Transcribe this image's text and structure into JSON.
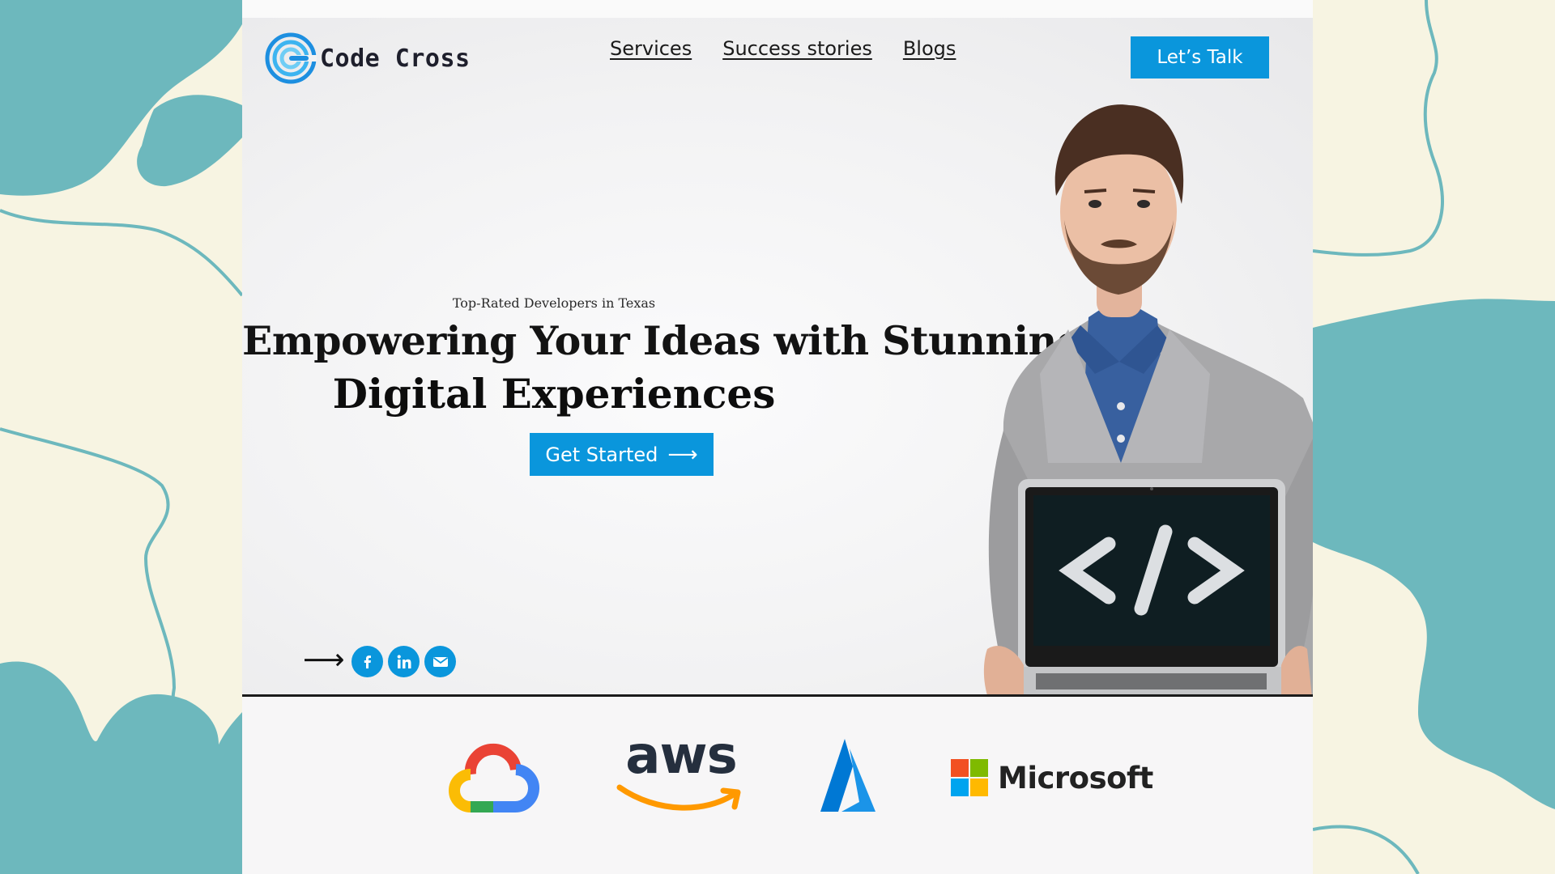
{
  "brand": {
    "name": "Code Cross"
  },
  "nav": {
    "items": [
      {
        "label": "Services"
      },
      {
        "label": "Success stories"
      },
      {
        "label": "Blogs"
      }
    ],
    "cta_label": "Let’s Talk"
  },
  "hero": {
    "kicker": "Top-Rated Developers in Texas",
    "headline": "Empowering Your Ideas with Stunning",
    "headline_bold": "Digital Experiences",
    "cta_label": "Get Started",
    "cta_arrow": "⟶"
  },
  "social": {
    "arrow": "⟶",
    "icons": [
      "facebook-icon",
      "linkedin-icon",
      "email-icon"
    ]
  },
  "partners": {
    "aws_text": "aws",
    "microsoft_text": "Microsoft",
    "logos": [
      "google-cloud-logo",
      "aws-logo",
      "azure-logo",
      "microsoft-logo"
    ]
  },
  "colors": {
    "accent": "#0a96dc",
    "teal_decor": "#6db8bd",
    "cream": "#f7f4e2",
    "text_dark": "#1e1f2c"
  }
}
